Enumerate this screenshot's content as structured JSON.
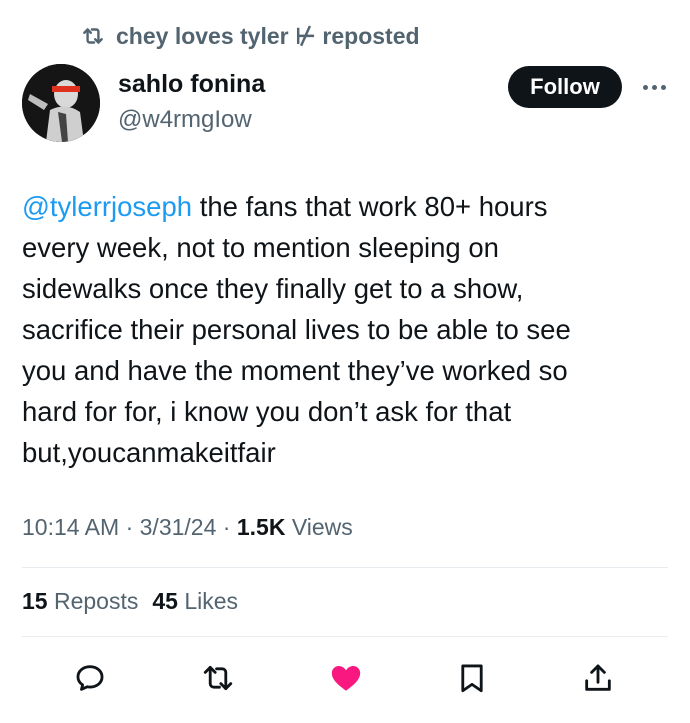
{
  "repost_banner": {
    "text": "chey loves tyler ⊬ reposted",
    "icon": "repost-icon"
  },
  "author": {
    "name": "sahlo fonina",
    "handle": "@w4rmgIow"
  },
  "follow_label": "Follow",
  "tweet": {
    "mention": "@tylerrjoseph",
    "line1_rest": " the fans that work 80+ hours",
    "line2": "every week, not to mention sleeping on",
    "line3": "sidewalks once they finally get to a show,",
    "line4": "sacrifice their personal lives to be able to see",
    "line5": "you and have the moment they’ve worked so",
    "line6": "hard for for, i know you don’t ask for that",
    "line7": "but,youcanmakeitfair"
  },
  "meta": {
    "time": "10:14 AM",
    "sep1": " · ",
    "date": "3/31/24",
    "sep2": " · ",
    "views_count": "1.5K",
    "views_label": " Views"
  },
  "stats": {
    "reposts_count": "15",
    "reposts_label": "Reposts",
    "likes_count": "45",
    "likes_label": "Likes"
  },
  "colors": {
    "accent": "#1d9bf0",
    "like": "#f91880",
    "text": "#0f1419",
    "muted": "#536471"
  },
  "action_icons": [
    "reply-icon",
    "repost-icon",
    "like-icon",
    "bookmark-icon",
    "share-icon"
  ]
}
